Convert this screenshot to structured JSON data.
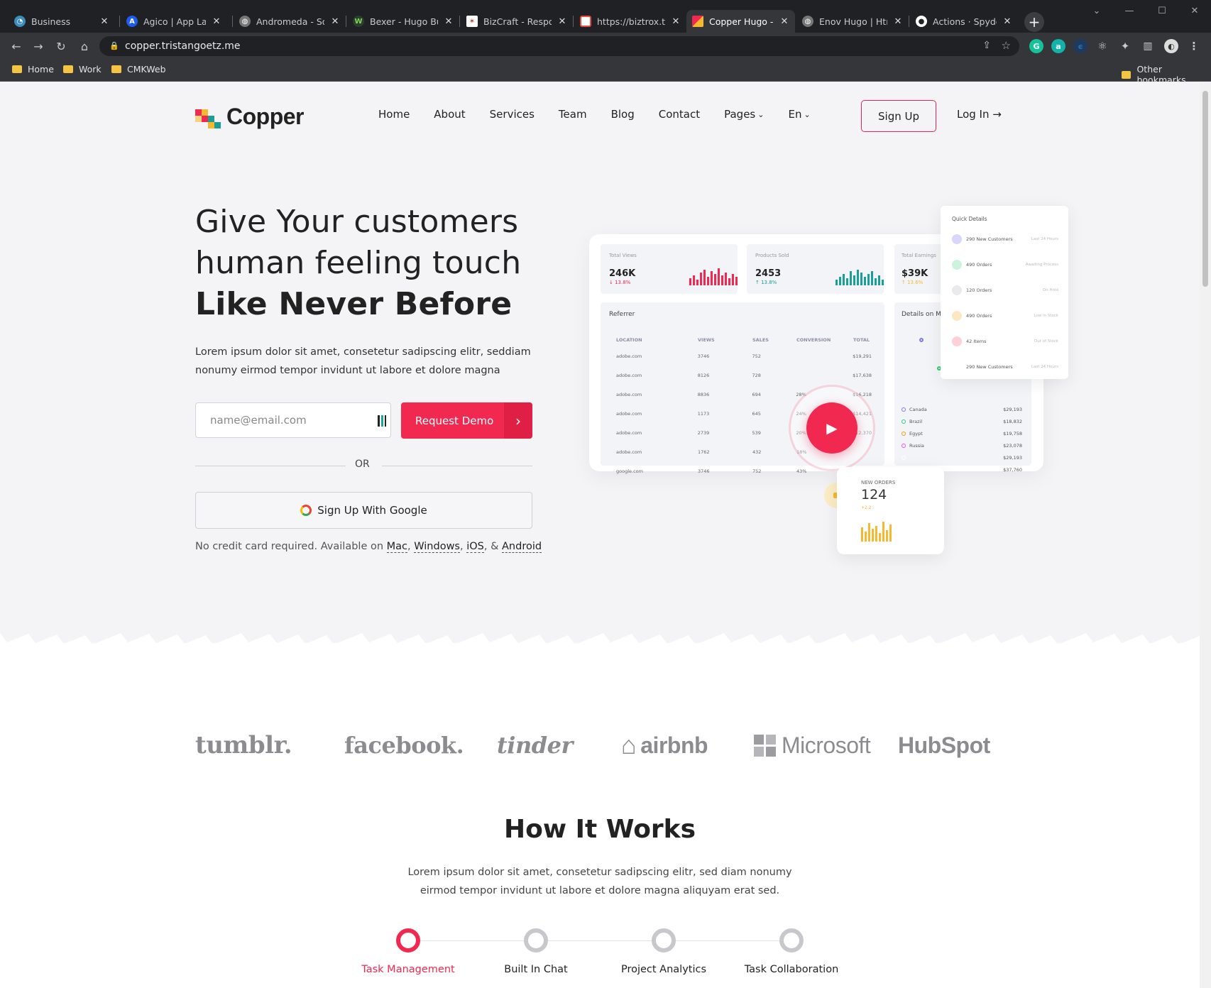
{
  "browser": {
    "tabs": [
      {
        "title": "Business",
        "favicon": "globe-icon",
        "color": "#3c8dbc"
      },
      {
        "title": "Agico | App Landi",
        "favicon": "agico-icon",
        "color": "#1f5cf0"
      },
      {
        "title": "Andromeda - Soft",
        "favicon": "globe-icon",
        "color": "#888888"
      },
      {
        "title": "Bexer - Hugo Busi",
        "favicon": "bexer-icon",
        "color": "#5cb85c"
      },
      {
        "title": "BizCraft - Respon",
        "favicon": "bizcraft-icon",
        "color": "#c0392b"
      },
      {
        "title": "https://biztrox.tri",
        "favicon": "biztrox-icon",
        "color": "#e74c3c"
      },
      {
        "title": "Copper Hugo - So",
        "favicon": "copper-icon",
        "color": "#f1284f"
      },
      {
        "title": "Enov Hugo | Html",
        "favicon": "globe-icon",
        "color": "#888888"
      },
      {
        "title": "Actions · SpyderH",
        "favicon": "github-icon",
        "color": "#ffffff"
      }
    ],
    "url": "copper.tristangoetz.me",
    "bookmarks": [
      "Home",
      "Work",
      "CMKWeb"
    ],
    "other_bookmarks": "Other bookmarks"
  },
  "header": {
    "logo": "Copper",
    "nav": [
      "Home",
      "About",
      "Services",
      "Team",
      "Blog",
      "Contact",
      "Pages",
      "En"
    ],
    "signup": "Sign Up",
    "login": "Log In →"
  },
  "hero": {
    "line1": "Give Your customers",
    "line2": "human feeling touch",
    "line3": "Like Never Before",
    "desc": "Lorem ipsum dolor sit amet, consetetur sadipscing elitr, seddiam nonumy eirmod tempor invidunt ut labore et dolore magna",
    "email_placeholder": "name@email.com",
    "demo_button": "Request Demo",
    "or": "OR",
    "google_button": "Sign Up With Google",
    "note_prefix": "No credit card required. Available on",
    "platforms": [
      "Mac",
      "Windows",
      "iOS",
      "Android"
    ],
    "note_sep": ",",
    "note_amp": "&"
  },
  "dashboard": {
    "stats": [
      {
        "label": "Total Views",
        "value": "246K",
        "delta": "↓ 13.8%",
        "color": "#f1284f"
      },
      {
        "label": "Products Sold",
        "value": "2453",
        "delta": "↑ 13.8%",
        "color": "#1a9e96"
      },
      {
        "label": "Total Earnings",
        "value": "$39K",
        "delta": "↑ 13.6%",
        "color": "#f5b82e"
      }
    ],
    "referrer_title": "Referrer",
    "columns": [
      "LOCATION",
      "VIEWS",
      "SALES",
      "CONVERSION",
      "TOTAL"
    ],
    "rows": [
      [
        "adobe.com",
        "3746",
        "752",
        "",
        "$19,291"
      ],
      [
        "adobe.com",
        "8126",
        "728",
        "",
        "$17,638"
      ],
      [
        "adobe.com",
        "8836",
        "694",
        "28%",
        "$16,218"
      ],
      [
        "adobe.com",
        "1173",
        "645",
        "24%",
        "$14,421"
      ],
      [
        "adobe.com",
        "2739",
        "539",
        "20%",
        "$12,370"
      ],
      [
        "adobe.com",
        "1762",
        "432",
        "18%",
        ""
      ],
      [
        "google.com",
        "3746",
        "752",
        "43%",
        ""
      ]
    ],
    "details_title": "Details on M",
    "countries": [
      {
        "name": "Canada",
        "value": "$29,193",
        "color": "#7b7bf0"
      },
      {
        "name": "Brazil",
        "value": "$18,832",
        "color": "#2ecc71"
      },
      {
        "name": "Egypt",
        "value": "$19,758",
        "color": "#f39c12"
      },
      {
        "name": "Russia",
        "value": "$23,078",
        "color": "#e056fd"
      },
      {
        "name": "",
        "value": "$29,193",
        "color": "#ffffff"
      },
      {
        "name": "",
        "value": "$37,760",
        "color": "#ffffff"
      }
    ],
    "quick_title": "Quick Details",
    "quick": [
      {
        "label": "290 New Customers",
        "right": "Last 24 Hours",
        "color": "#d9d6fb"
      },
      {
        "label": "490 Orders",
        "right": "Awaiting Process",
        "color": "#cdf3dd"
      },
      {
        "label": "120 Orders",
        "right": "On Hold",
        "color": "#e9e9ee"
      },
      {
        "label": "490 Orders",
        "right": "Low in Stock",
        "color": "#fde6c2"
      },
      {
        "label": "42 Items",
        "right": "Out of Stock",
        "color": "#fdd0d8"
      },
      {
        "label": "290 New Customers",
        "right": "Last 24 Hours",
        "color": "#ffffff"
      }
    ],
    "new_orders_label": "NEW ORDERS",
    "new_orders_value": "124",
    "new_orders_delta": "+2.2"
  },
  "brands": [
    "tumblr.",
    "facebook.",
    "tinder",
    "airbnb",
    "Microsoft",
    "HubSpot"
  ],
  "how": {
    "title_light": "How",
    "title_bold": "It Works",
    "desc": "Lorem ipsum dolor sit amet, consetetur sadipscing elitr, sed diam nonumy eirmod tempor invidunt ut labore et dolore magna aliquyam erat sed.",
    "steps": [
      "Task Management",
      "Built In Chat",
      "Project Analytics",
      "Task Collaboration"
    ],
    "active_step": 0
  },
  "colors": {
    "accent": "#f1284f",
    "teal": "#1a9e96",
    "yellow": "#f5b82e"
  }
}
